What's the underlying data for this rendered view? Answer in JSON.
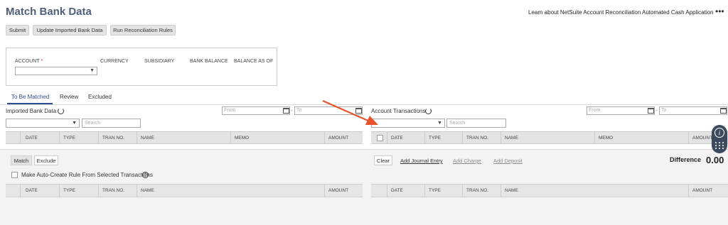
{
  "header": {
    "title": "Match Bank Data",
    "links": [
      "Learn about NetSuite Account Reconciliation",
      "Automated Cash Application"
    ],
    "more_icon": "more-dots-icon"
  },
  "toolbar": {
    "submit": "Submit",
    "update": "Update Imported Bank Data",
    "run_rules": "Run Reconciliation Rules"
  },
  "account_panel": {
    "account_label": "ACCOUNT",
    "required_marker": "*",
    "currency_label": "CURRENCY",
    "subsidiary_label": "SUBSIDIARY",
    "bank_balance_label": "BANK BALANCE",
    "balance_as_of_label": "BALANCE AS OF"
  },
  "tabs": [
    "To Be Matched",
    "Review",
    "Excluded"
  ],
  "imported": {
    "title": "Imported Bank Data",
    "from_placeholder": "From",
    "to_placeholder": "To",
    "search_placeholder": "Search",
    "columns": [
      "DATE",
      "TYPE",
      "TRAN NO.",
      "NAME",
      "MEMO",
      "AMOUNT"
    ]
  },
  "account_tx": {
    "title": "Account Transactions",
    "from_placeholder": "From",
    "to_placeholder": "To",
    "search_placeholder": "Search",
    "columns": [
      "DATE",
      "TYPE",
      "TRAN NO.",
      "NAME",
      "MEMO",
      "AMOUNT"
    ]
  },
  "actions": {
    "match": "Match",
    "exclude": "Exclude",
    "auto_rule": "Make Auto-Create Rule From Selected Transactions",
    "clear": "Clear",
    "add_journal": "Add Journal Entry",
    "add_charge": "Add Charge",
    "add_deposit": "Add Deposit",
    "difference_label": "Difference",
    "difference_value": "0.00"
  },
  "lower_left_columns": [
    "DATE",
    "TYPE",
    "TRAN NO.",
    "NAME",
    "AMOUNT"
  ],
  "lower_right_columns": [
    "DATE",
    "TYPE",
    "TRAN NO.",
    "NAME",
    "AMOUNT"
  ],
  "colors": {
    "title": "#4d5f79",
    "active_tab": "#2a4e8c",
    "annotation_arrow": "#e8532b",
    "widget": "#3b4a5c"
  }
}
